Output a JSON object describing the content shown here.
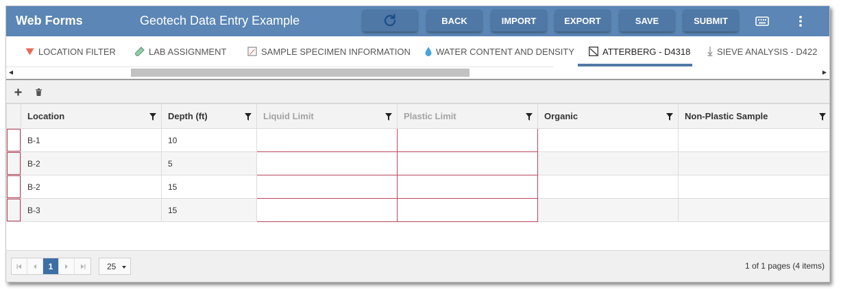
{
  "header": {
    "app_name": "Web Forms",
    "document_title": "Geotech Data Entry Example",
    "buttons": {
      "refresh": "refresh-icon",
      "back": "BACK",
      "import": "IMPORT",
      "export": "EXPORT",
      "save": "SAVE",
      "submit": "SUBMIT",
      "keyboard": "keyboard-icon",
      "more": "more-vertical-icon"
    },
    "colors": {
      "bar": "#5b86b5",
      "button": "#4f78a6"
    }
  },
  "tabs": [
    {
      "label": "LOCATION FILTER",
      "icon": "filter-icon",
      "active": false
    },
    {
      "label": "LAB ASSIGNMENT",
      "icon": "test-tube-icon",
      "active": false
    },
    {
      "label": "SAMPLE SPECIMEN INFORMATION",
      "icon": "edit-icon",
      "active": false
    },
    {
      "label": "WATER CONTENT AND DENSITY",
      "icon": "water-drop-icon",
      "active": false
    },
    {
      "label": "ATTERBERG - D4318",
      "icon": "chart-icon",
      "active": true
    },
    {
      "label": "SIEVE ANALYSIS - D422",
      "icon": "sieve-icon",
      "active": false
    }
  ],
  "toolbar": {
    "add": "add-icon",
    "delete": "trash-icon"
  },
  "grid": {
    "columns": [
      {
        "label": "Location",
        "enabled": true
      },
      {
        "label": "Depth (ft)",
        "enabled": true
      },
      {
        "label": "Liquid Limit",
        "enabled": false
      },
      {
        "label": "Plastic Limit",
        "enabled": false
      },
      {
        "label": "Organic",
        "enabled": true
      },
      {
        "label": "Non-Plastic Sample",
        "enabled": true
      }
    ],
    "rows": [
      {
        "location": "B-1",
        "depth": "10",
        "liquid_limit": "",
        "plastic_limit": "",
        "organic": "",
        "non_plastic": ""
      },
      {
        "location": "B-2",
        "depth": "5",
        "liquid_limit": "",
        "plastic_limit": "",
        "organic": "",
        "non_plastic": ""
      },
      {
        "location": "B-2",
        "depth": "15",
        "liquid_limit": "",
        "plastic_limit": "",
        "organic": "",
        "non_plastic": ""
      },
      {
        "location": "B-3",
        "depth": "15",
        "liquid_limit": "",
        "plastic_limit": "",
        "organic": "",
        "non_plastic": ""
      }
    ]
  },
  "pager": {
    "current_page": "1",
    "page_size": "25",
    "info": "1 of 1 pages (4 items)"
  }
}
